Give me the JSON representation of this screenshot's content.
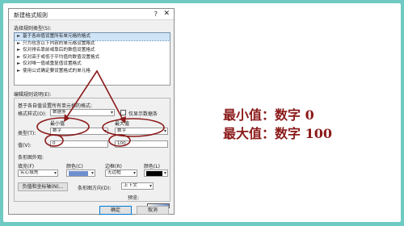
{
  "dialog": {
    "title": "新建格式规则",
    "help_glyph": "?",
    "close_glyph": "✕",
    "rule_type_label": "选择规则类型(S):",
    "rule_types": [
      "基于各自值设置所有单元格的格式",
      "只为包含以下内容的单元格设置格式",
      "仅对排名靠前或靠后的数值设置格式",
      "仅对高于或低于平均值的数值设置格式",
      "仅对唯一值或重复值设置格式",
      "使用公式确定要设置格式的单元格"
    ],
    "selected_rule_index": 0,
    "edit_label": "编辑规则说明(E):",
    "edit_heading": "基于各自值设置所有单元格的格式:",
    "format_style_label": "格式样式(O):",
    "format_style_value": "数据条",
    "show_bar_only_label": "仅显示数据条",
    "min_label": "最小值",
    "max_label": "最大值",
    "type_label": "类型(T):",
    "min_type": "数字",
    "max_type": "数字",
    "value_label": "值(V):",
    "min_value": "0",
    "max_value": "100",
    "bar_appearance_label": "条形图外观:",
    "fill_label": "填充(F)",
    "fill_value": "实心填充",
    "color_label": "颜色(C)",
    "border_label": "边框(R)",
    "border_value": "无边框",
    "border_color_label": "颜色(L)",
    "negative_button": "负值和坐标轴(N)...",
    "bar_direction_label": "条形图方向(D):",
    "bar_direction_value": "上下文",
    "preview_label": "预览:",
    "ok_label": "确定",
    "cancel_label": "取消",
    "fill_color": "#6e8fcf",
    "border_color": "#000000"
  },
  "annotations": {
    "min_note": "最小值：数字 0",
    "max_note": "最大值：数字 100",
    "mark_color": "#8b1a1a"
  }
}
